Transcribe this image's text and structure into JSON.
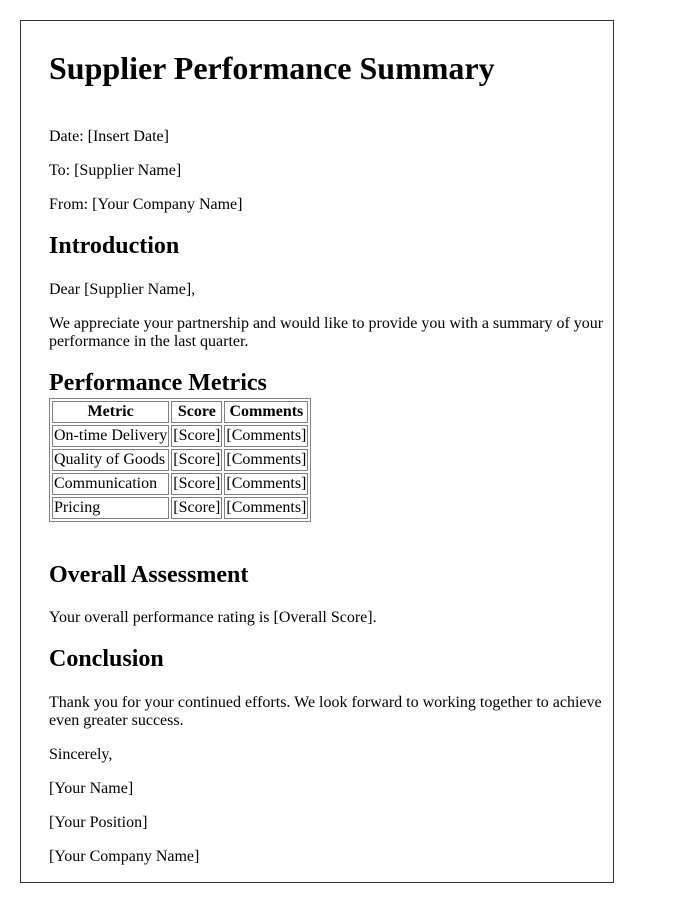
{
  "document": {
    "title": "Supplier Performance Summary",
    "header_lines": {
      "date": "Date: [Insert Date]",
      "to": "To: [Supplier Name]",
      "from": "From: [Your Company Name]"
    },
    "sections": {
      "introduction": {
        "heading": "Introduction",
        "salutation": "Dear [Supplier Name],",
        "body": "We appreciate your partnership and would like to provide you with a summary of your performance in the last quarter."
      },
      "metrics": {
        "heading": "Performance Metrics",
        "table": {
          "headers": [
            "Metric",
            "Score",
            "Comments"
          ],
          "rows": [
            [
              "On-time Delivery",
              "[Score]",
              "[Comments]"
            ],
            [
              "Quality of Goods",
              "[Score]",
              "[Comments]"
            ],
            [
              "Communication",
              "[Score]",
              "[Comments]"
            ],
            [
              "Pricing",
              "[Score]",
              "[Comments]"
            ]
          ]
        }
      },
      "assessment": {
        "heading": "Overall Assessment",
        "body": "Your overall performance rating is [Overall Score]."
      },
      "conclusion": {
        "heading": "Conclusion",
        "body": "Thank you for your continued efforts. We look forward to working together to achieve even greater success."
      }
    },
    "closing": {
      "signoff": "Sincerely,",
      "name": "[Your Name]",
      "position": "[Your Position]",
      "company": "[Your Company Name]"
    }
  }
}
